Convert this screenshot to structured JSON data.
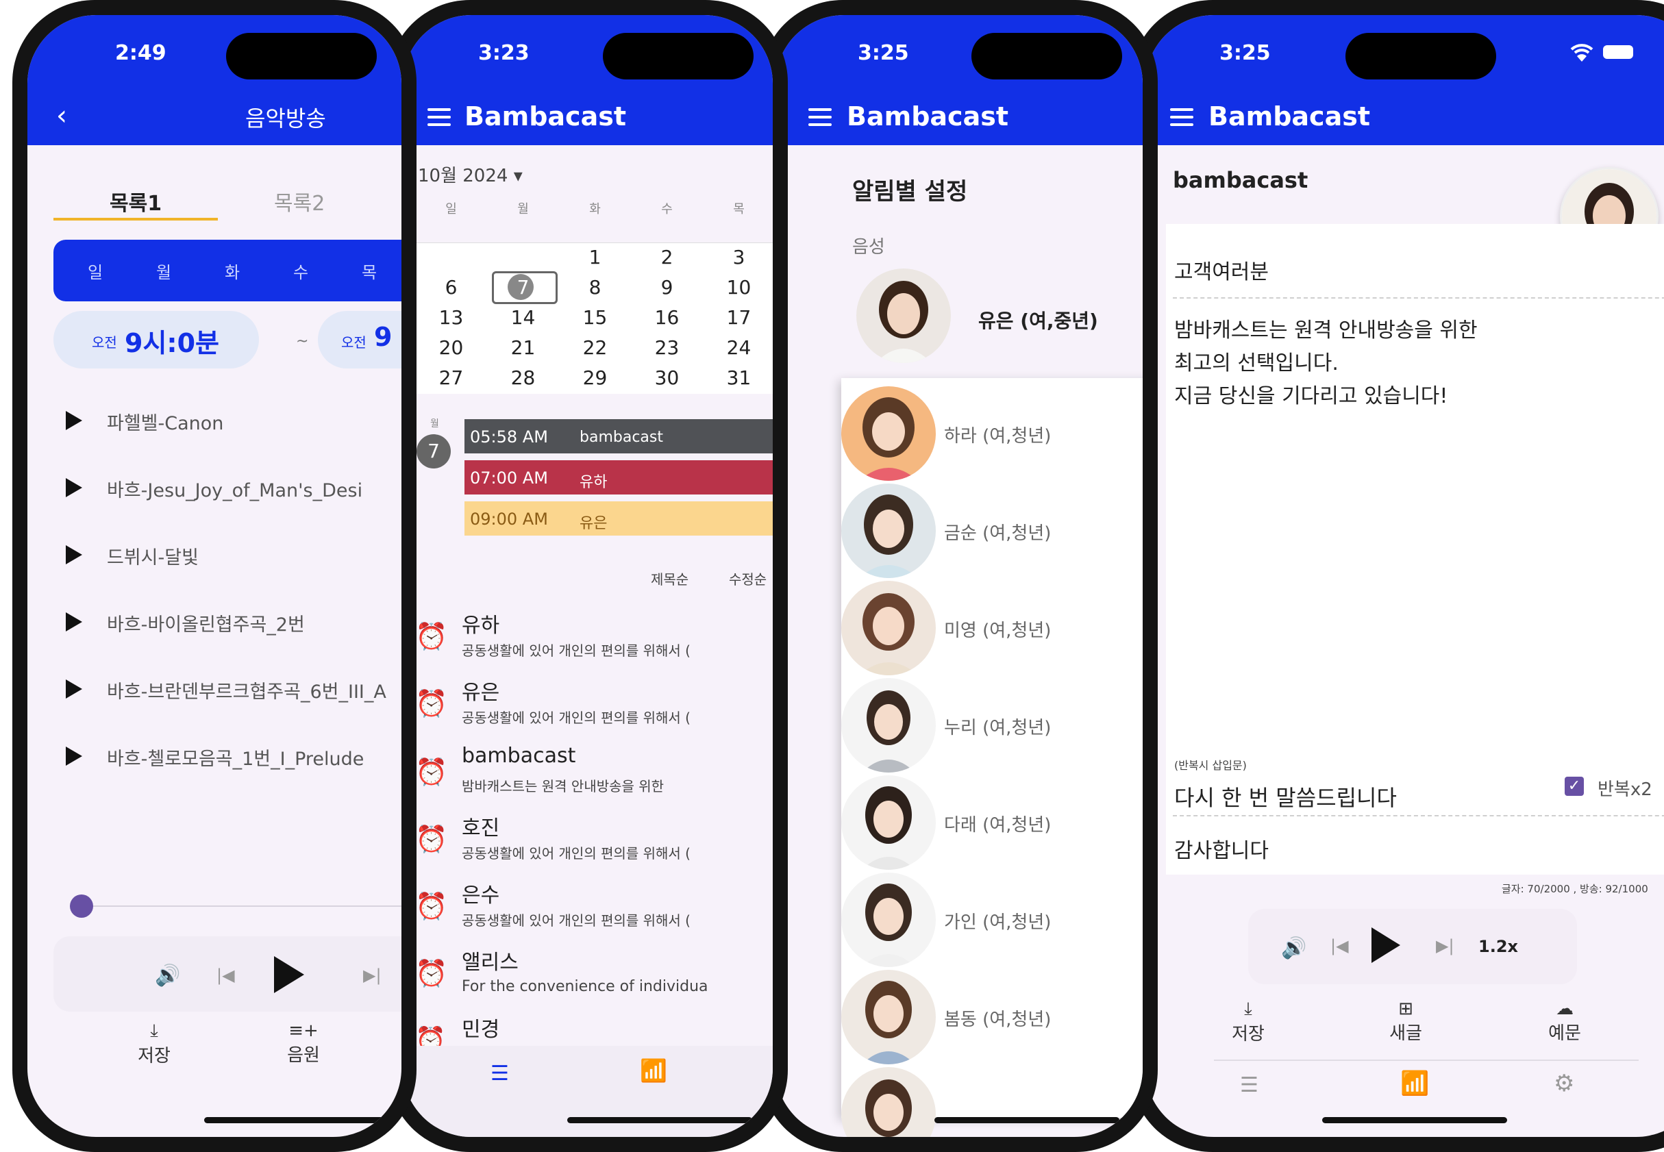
{
  "phone1": {
    "time": "2:49",
    "title": "음악방송",
    "tabs": [
      "목록1",
      "목록2"
    ],
    "days": [
      "일",
      "월",
      "화",
      "수",
      "목"
    ],
    "time_start_prefix": "오전",
    "time_start_value": "9시:0분",
    "time_sep": "~",
    "time_end_prefix": "오전",
    "time_end_value": "9",
    "tracks": [
      "파헬벨-Canon",
      "바흐-Jesu_Joy_of_Man's_Desi",
      "드뷔시-달빛",
      "바흐-바이올린협주곡_2번",
      "바흐-브란덴부르크협주곡_6번_III_A",
      "바흐-첼로모음곡_1번_I_Prelude"
    ],
    "save_label": "저장",
    "source_label": "음원"
  },
  "phone2": {
    "time": "3:23",
    "brand": "Bambacast",
    "month": "10월 2024 ▾",
    "weekdays": [
      "일",
      "월",
      "화",
      "수",
      "목"
    ],
    "calendar_rows": [
      [
        "",
        "",
        "1",
        "2",
        "3"
      ],
      [
        "6",
        "7",
        "8",
        "9",
        "10"
      ],
      [
        "13",
        "14",
        "15",
        "16",
        "17"
      ],
      [
        "20",
        "21",
        "22",
        "23",
        "24"
      ],
      [
        "27",
        "28",
        "29",
        "30",
        "31"
      ]
    ],
    "selected_day_label": "월",
    "selected_day": "7",
    "events": [
      {
        "time": "05:58 AM",
        "name": "bambacast",
        "color": "#505256",
        "text_color": "#ffffff"
      },
      {
        "time": "07:00 AM",
        "name": "유하",
        "color": "#b93349",
        "text_color": "#ffffff"
      },
      {
        "time": "09:00 AM",
        "name": "유은",
        "color": "#fbd68e",
        "text_color": "#8a5b14"
      }
    ],
    "sort_title": "제목순",
    "sort_modified": "수정순",
    "alarms": [
      {
        "title": "유하",
        "desc": "공동생활에 있어 개인의 편의를 위해서 ("
      },
      {
        "title": "유은",
        "desc": "공동생활에 있어 개인의 편의를 위해서 ("
      },
      {
        "title": "bambacast",
        "desc": "밤바캐스트는 원격 안내방송을 위한"
      },
      {
        "title": "호진",
        "desc": "공동생활에 있어 개인의 편의를 위해서 ("
      },
      {
        "title": "은수",
        "desc": "공동생활에 있어 개인의 편의를 위해서 ("
      },
      {
        "title": "앨리스",
        "desc": "For the convenience of individua"
      },
      {
        "title": "민경",
        "desc": ""
      }
    ]
  },
  "phone3": {
    "time": "3:25",
    "brand": "Bambacast",
    "section_title": "알림별 설정",
    "voice_label": "음성",
    "current_voice": "유은 (여,중년)",
    "voices": [
      "하라 (여,청년)",
      "금순 (여,청년)",
      "미영 (여,청년)",
      "누리 (여,청년)",
      "다래 (여,청년)",
      "가인 (여,청년)",
      "봄동 (여,청년)"
    ]
  },
  "phone4": {
    "time": "3:25",
    "brand": "Bambacast",
    "name": "bambacast",
    "greeting": "고객여러분",
    "body_lines": [
      "밤바캐스트는 원격 안내방송을 위한",
      "최고의 선택입니다.",
      "지금 당신을 기다리고 있습니다!"
    ],
    "repeat_hint": "(반복시 삽입문)",
    "repeat_text": "다시 한 번 말씀드립니다",
    "repeat_label": "반복x2",
    "closing": "감사합니다",
    "counter": "글자: 70/2000 , 방송: 92/1000",
    "speed": "1.2x",
    "save_label": "저장",
    "new_label": "새글",
    "sample_label": "예문"
  },
  "colors": {
    "header_blue": "#1230e6",
    "accent_purple": "#6750a4",
    "tab_underline": "#f0b429",
    "alarm_orange": "#f1a12a"
  }
}
